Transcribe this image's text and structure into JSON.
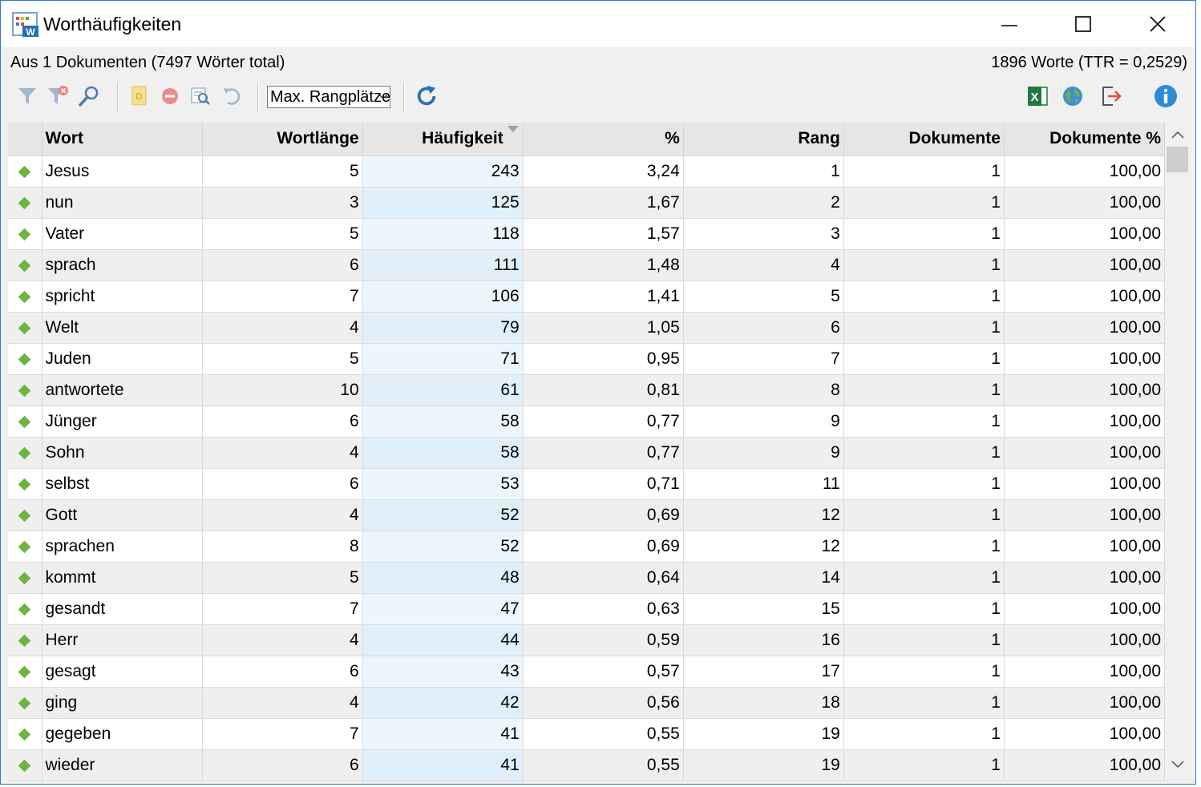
{
  "window": {
    "title": "Worthäufigkeiten"
  },
  "info": {
    "left": "Aus 1 Dokumenten (7497 Wörter total)",
    "right": "1896 Worte (TTR = 0,2529)"
  },
  "toolbar": {
    "select_value": "Max. Rangplätze",
    "icons": [
      "filter-icon",
      "remove-filter-icon",
      "search-icon",
      "document-icon",
      "stop-icon",
      "preview-icon",
      "undo-icon",
      "refresh-icon",
      "excel-icon",
      "web-export-icon",
      "exit-icon",
      "info-icon"
    ]
  },
  "table": {
    "columns": [
      "Wort",
      "Wortlänge",
      "Häufigkeit",
      "%",
      "Rang",
      "Dokumente",
      "Dokumente %"
    ],
    "sorted_column": "Häufigkeit",
    "rows": [
      {
        "wort": "Jesus",
        "laenge": "5",
        "haeufigkeit": "243",
        "prozent": "3,24",
        "rang": "1",
        "dokumente": "1",
        "dok_prozent": "100,00"
      },
      {
        "wort": "nun",
        "laenge": "3",
        "haeufigkeit": "125",
        "prozent": "1,67",
        "rang": "2",
        "dokumente": "1",
        "dok_prozent": "100,00"
      },
      {
        "wort": "Vater",
        "laenge": "5",
        "haeufigkeit": "118",
        "prozent": "1,57",
        "rang": "3",
        "dokumente": "1",
        "dok_prozent": "100,00"
      },
      {
        "wort": "sprach",
        "laenge": "6",
        "haeufigkeit": "111",
        "prozent": "1,48",
        "rang": "4",
        "dokumente": "1",
        "dok_prozent": "100,00"
      },
      {
        "wort": "spricht",
        "laenge": "7",
        "haeufigkeit": "106",
        "prozent": "1,41",
        "rang": "5",
        "dokumente": "1",
        "dok_prozent": "100,00"
      },
      {
        "wort": "Welt",
        "laenge": "4",
        "haeufigkeit": "79",
        "prozent": "1,05",
        "rang": "6",
        "dokumente": "1",
        "dok_prozent": "100,00"
      },
      {
        "wort": "Juden",
        "laenge": "5",
        "haeufigkeit": "71",
        "prozent": "0,95",
        "rang": "7",
        "dokumente": "1",
        "dok_prozent": "100,00"
      },
      {
        "wort": "antwortete",
        "laenge": "10",
        "haeufigkeit": "61",
        "prozent": "0,81",
        "rang": "8",
        "dokumente": "1",
        "dok_prozent": "100,00"
      },
      {
        "wort": "Jünger",
        "laenge": "6",
        "haeufigkeit": "58",
        "prozent": "0,77",
        "rang": "9",
        "dokumente": "1",
        "dok_prozent": "100,00"
      },
      {
        "wort": "Sohn",
        "laenge": "4",
        "haeufigkeit": "58",
        "prozent": "0,77",
        "rang": "9",
        "dokumente": "1",
        "dok_prozent": "100,00"
      },
      {
        "wort": "selbst",
        "laenge": "6",
        "haeufigkeit": "53",
        "prozent": "0,71",
        "rang": "11",
        "dokumente": "1",
        "dok_prozent": "100,00"
      },
      {
        "wort": "Gott",
        "laenge": "4",
        "haeufigkeit": "52",
        "prozent": "0,69",
        "rang": "12",
        "dokumente": "1",
        "dok_prozent": "100,00"
      },
      {
        "wort": "sprachen",
        "laenge": "8",
        "haeufigkeit": "52",
        "prozent": "0,69",
        "rang": "12",
        "dokumente": "1",
        "dok_prozent": "100,00"
      },
      {
        "wort": "kommt",
        "laenge": "5",
        "haeufigkeit": "48",
        "prozent": "0,64",
        "rang": "14",
        "dokumente": "1",
        "dok_prozent": "100,00"
      },
      {
        "wort": "gesandt",
        "laenge": "7",
        "haeufigkeit": "47",
        "prozent": "0,63",
        "rang": "15",
        "dokumente": "1",
        "dok_prozent": "100,00"
      },
      {
        "wort": "Herr",
        "laenge": "4",
        "haeufigkeit": "44",
        "prozent": "0,59",
        "rang": "16",
        "dokumente": "1",
        "dok_prozent": "100,00"
      },
      {
        "wort": "gesagt",
        "laenge": "6",
        "haeufigkeit": "43",
        "prozent": "0,57",
        "rang": "17",
        "dokumente": "1",
        "dok_prozent": "100,00"
      },
      {
        "wort": "ging",
        "laenge": "4",
        "haeufigkeit": "42",
        "prozent": "0,56",
        "rang": "18",
        "dokumente": "1",
        "dok_prozent": "100,00"
      },
      {
        "wort": "gegeben",
        "laenge": "7",
        "haeufigkeit": "41",
        "prozent": "0,55",
        "rang": "19",
        "dokumente": "1",
        "dok_prozent": "100,00"
      },
      {
        "wort": "wieder",
        "laenge": "6",
        "haeufigkeit": "41",
        "prozent": "0,55",
        "rang": "19",
        "dokumente": "1",
        "dok_prozent": "100,00"
      }
    ]
  },
  "colors": {
    "window_border": "#2b79d8",
    "row_indicator": "#6eb43f",
    "refresh_blue": "#2a6fb5",
    "excel_green": "#1f7a3d",
    "info_blue": "#2e8ad8",
    "sorted_column_tint": "#e1effb"
  }
}
